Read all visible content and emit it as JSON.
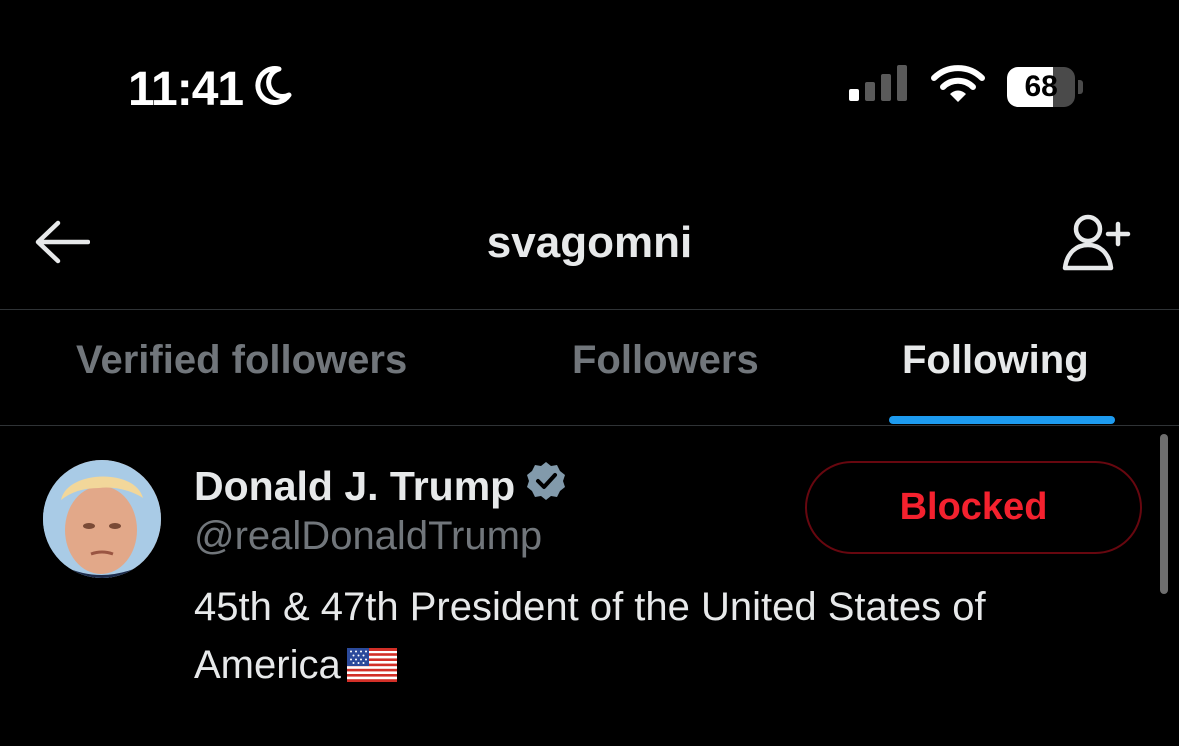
{
  "status_bar": {
    "time": "11:41",
    "focus_icon": "moon-icon",
    "signal_icon": "cellular-signal-icon",
    "wifi_icon": "wifi-icon",
    "battery_level": "68",
    "battery_fraction": 0.68
  },
  "header": {
    "back_icon": "arrow-left-icon",
    "title": "svagomni",
    "add_user_icon": "add-user-icon"
  },
  "tabs": [
    {
      "label": "Verified followers",
      "active": false
    },
    {
      "label": "Followers",
      "active": false
    },
    {
      "label": "Following",
      "active": true
    }
  ],
  "accent_color": "#1d9bf0",
  "users": [
    {
      "name": "Donald J. Trump",
      "verified_icon": "verified-badge-icon",
      "handle": "@realDonaldTrump",
      "bio": "45th & 47th President of the United States of America",
      "bio_emoji": "us-flag-icon",
      "action_label": "Blocked",
      "action_color": "#f4212e"
    }
  ]
}
